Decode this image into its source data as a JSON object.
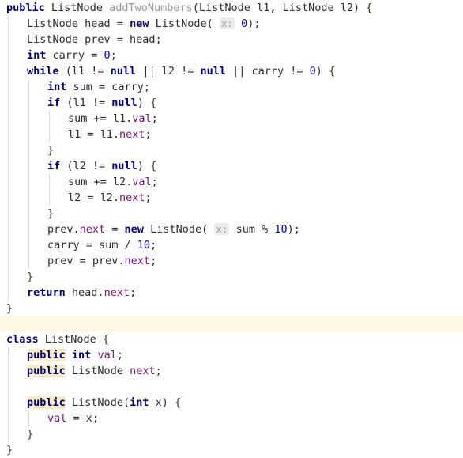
{
  "editor": {
    "language": "java",
    "theme": "intellij-light",
    "colors": {
      "background": "#ffffff",
      "keyword": "#000080",
      "number": "#0000d0",
      "identifier": "#2b2b2b",
      "field": "#7a0f7a",
      "greyed_method": "#9a9a9a",
      "brace": "#3d3a25",
      "hint_chip_bg": "#ebebeb",
      "hint_chip_text": "#9a9a9a",
      "search_highlight": "#f7ecc3",
      "separator_band": "#fdf8e3",
      "indent_guide": "#d8d8d8"
    }
  },
  "separator": {
    "label": ""
  },
  "block_method": {
    "name": "addTwoNumbers-method",
    "lines": [
      {
        "indent": 0,
        "tokens": [
          {
            "t": "public",
            "c": "kw"
          },
          {
            "t": " ",
            "c": "pun"
          },
          {
            "t": "ListNode",
            "c": "typ"
          },
          {
            "t": " ",
            "c": "pun"
          },
          {
            "t": "addTwoNumbers",
            "c": "meth"
          },
          {
            "t": "(",
            "c": "pun"
          },
          {
            "t": "ListNode",
            "c": "typ"
          },
          {
            "t": " l1, ",
            "c": "id"
          },
          {
            "t": "ListNode",
            "c": "typ"
          },
          {
            "t": " l2) ",
            "c": "id"
          },
          {
            "t": "{",
            "c": "brc"
          }
        ]
      },
      {
        "indent": 1,
        "tokens": [
          {
            "t": "ListNode",
            "c": "typ"
          },
          {
            "t": " head = ",
            "c": "id"
          },
          {
            "t": "new",
            "c": "kw"
          },
          {
            "t": " ",
            "c": "pun"
          },
          {
            "t": "ListNode",
            "c": "typ"
          },
          {
            "t": "(",
            "c": "pun"
          },
          {
            "t": " ",
            "c": "pun"
          },
          {
            "t": "x:",
            "c": "hint"
          },
          {
            "t": " ",
            "c": "pun"
          },
          {
            "t": "0",
            "c": "num"
          },
          {
            "t": ");",
            "c": "pun"
          }
        ]
      },
      {
        "indent": 1,
        "tokens": [
          {
            "t": "ListNode",
            "c": "typ"
          },
          {
            "t": " prev = head;",
            "c": "id"
          }
        ]
      },
      {
        "indent": 1,
        "tokens": [
          {
            "t": "int",
            "c": "kw"
          },
          {
            "t": " carry = ",
            "c": "id"
          },
          {
            "t": "0",
            "c": "num"
          },
          {
            "t": ";",
            "c": "pun"
          }
        ]
      },
      {
        "indent": 1,
        "tokens": [
          {
            "t": "while",
            "c": "kw"
          },
          {
            "t": " (l1 != ",
            "c": "id"
          },
          {
            "t": "null",
            "c": "kw"
          },
          {
            "t": " || l2 != ",
            "c": "id"
          },
          {
            "t": "null",
            "c": "kw"
          },
          {
            "t": " || carry != ",
            "c": "id"
          },
          {
            "t": "0",
            "c": "num"
          },
          {
            "t": ") ",
            "c": "pun"
          },
          {
            "t": "{",
            "c": "brc"
          }
        ]
      },
      {
        "indent": 2,
        "tokens": [
          {
            "t": "int",
            "c": "kw"
          },
          {
            "t": " sum = carry;",
            "c": "id"
          }
        ]
      },
      {
        "indent": 2,
        "tokens": [
          {
            "t": "if",
            "c": "kw"
          },
          {
            "t": " (l1 != ",
            "c": "id"
          },
          {
            "t": "null",
            "c": "kw"
          },
          {
            "t": ") ",
            "c": "pun"
          },
          {
            "t": "{",
            "c": "brc"
          }
        ]
      },
      {
        "indent": 3,
        "tokens": [
          {
            "t": "sum += l1.",
            "c": "id"
          },
          {
            "t": "val",
            "c": "fld"
          },
          {
            "t": ";",
            "c": "pun"
          }
        ]
      },
      {
        "indent": 3,
        "tokens": [
          {
            "t": "l1 = l1.",
            "c": "id"
          },
          {
            "t": "next",
            "c": "fld"
          },
          {
            "t": ";",
            "c": "pun"
          }
        ]
      },
      {
        "indent": 2,
        "tokens": [
          {
            "t": "}",
            "c": "brc"
          }
        ]
      },
      {
        "indent": 2,
        "tokens": [
          {
            "t": "if",
            "c": "kw"
          },
          {
            "t": " (l2 != ",
            "c": "id"
          },
          {
            "t": "null",
            "c": "kw"
          },
          {
            "t": ") ",
            "c": "pun"
          },
          {
            "t": "{",
            "c": "brc"
          }
        ]
      },
      {
        "indent": 3,
        "tokens": [
          {
            "t": "sum += l2.",
            "c": "id"
          },
          {
            "t": "val",
            "c": "fld"
          },
          {
            "t": ";",
            "c": "pun"
          }
        ]
      },
      {
        "indent": 3,
        "tokens": [
          {
            "t": "l2 = l2.",
            "c": "id"
          },
          {
            "t": "next",
            "c": "fld"
          },
          {
            "t": ";",
            "c": "pun"
          }
        ]
      },
      {
        "indent": 2,
        "tokens": [
          {
            "t": "}",
            "c": "brc"
          }
        ]
      },
      {
        "indent": 2,
        "tokens": [
          {
            "t": "prev.",
            "c": "id"
          },
          {
            "t": "next",
            "c": "fld"
          },
          {
            "t": " = ",
            "c": "id"
          },
          {
            "t": "new",
            "c": "kw"
          },
          {
            "t": " ",
            "c": "pun"
          },
          {
            "t": "ListNode",
            "c": "typ"
          },
          {
            "t": "(",
            "c": "pun"
          },
          {
            "t": " ",
            "c": "pun"
          },
          {
            "t": "x:",
            "c": "hint"
          },
          {
            "t": " ",
            "c": "pun"
          },
          {
            "t": "sum % ",
            "c": "id"
          },
          {
            "t": "10",
            "c": "num"
          },
          {
            "t": ");",
            "c": "pun"
          }
        ]
      },
      {
        "indent": 2,
        "tokens": [
          {
            "t": "carry = sum / ",
            "c": "id"
          },
          {
            "t": "10",
            "c": "num"
          },
          {
            "t": ";",
            "c": "pun"
          }
        ]
      },
      {
        "indent": 2,
        "tokens": [
          {
            "t": "prev = prev.",
            "c": "id"
          },
          {
            "t": "next",
            "c": "fld"
          },
          {
            "t": ";",
            "c": "pun"
          }
        ]
      },
      {
        "indent": 1,
        "tokens": [
          {
            "t": "}",
            "c": "brc"
          }
        ]
      },
      {
        "indent": 1,
        "tokens": [
          {
            "t": "return",
            "c": "kw"
          },
          {
            "t": " head.",
            "c": "id"
          },
          {
            "t": "next",
            "c": "fld"
          },
          {
            "t": ";",
            "c": "pun"
          }
        ]
      },
      {
        "indent": 0,
        "tokens": [
          {
            "t": "}",
            "c": "brc"
          }
        ]
      }
    ]
  },
  "block_class": {
    "name": "ListNode-class",
    "lines": [
      {
        "indent": 0,
        "tokens": [
          {
            "t": "class",
            "c": "kw"
          },
          {
            "t": " ",
            "c": "pun"
          },
          {
            "t": "ListNode",
            "c": "typ"
          },
          {
            "t": " ",
            "c": "pun"
          },
          {
            "t": "{",
            "c": "brc"
          }
        ]
      },
      {
        "indent": 1,
        "tokens": [
          {
            "t": "public",
            "c": "kw",
            "hl": true
          },
          {
            "t": " ",
            "c": "pun"
          },
          {
            "t": "int",
            "c": "kw"
          },
          {
            "t": " ",
            "c": "pun"
          },
          {
            "t": "val",
            "c": "fld"
          },
          {
            "t": ";",
            "c": "pun"
          }
        ]
      },
      {
        "indent": 1,
        "tokens": [
          {
            "t": "public",
            "c": "kw",
            "hl": true
          },
          {
            "t": " ",
            "c": "pun"
          },
          {
            "t": "ListNode",
            "c": "typ"
          },
          {
            "t": " ",
            "c": "pun"
          },
          {
            "t": "next",
            "c": "fld"
          },
          {
            "t": ";",
            "c": "pun"
          }
        ]
      },
      {
        "indent": 1,
        "tokens": [
          {
            "t": "",
            "c": "pun"
          }
        ]
      },
      {
        "indent": 1,
        "tokens": [
          {
            "t": "public",
            "c": "kw",
            "hl": true
          },
          {
            "t": " ",
            "c": "pun"
          },
          {
            "t": "ListNode",
            "c": "typ"
          },
          {
            "t": "(",
            "c": "pun"
          },
          {
            "t": "int",
            "c": "kw"
          },
          {
            "t": " x) ",
            "c": "id"
          },
          {
            "t": "{",
            "c": "brc"
          }
        ]
      },
      {
        "indent": 2,
        "tokens": [
          {
            "t": "val",
            "c": "fld"
          },
          {
            "t": " = x;",
            "c": "id"
          }
        ]
      },
      {
        "indent": 1,
        "tokens": [
          {
            "t": "}",
            "c": "brc"
          }
        ]
      },
      {
        "indent": 0,
        "tokens": [
          {
            "t": "}",
            "c": "brc"
          }
        ]
      }
    ]
  }
}
